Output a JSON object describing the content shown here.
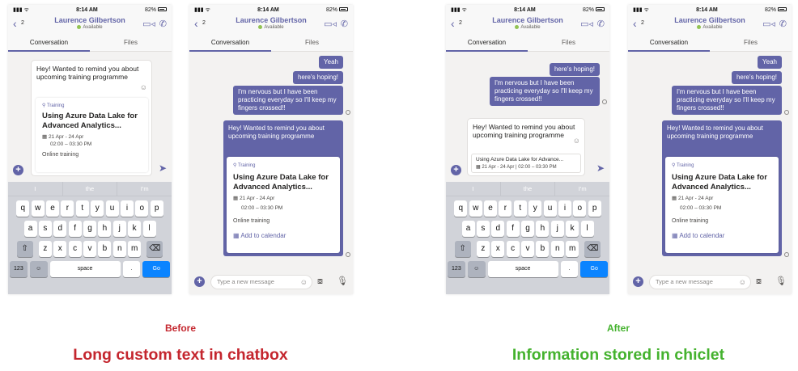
{
  "status": {
    "time": "8:14 AM",
    "battery": "82%"
  },
  "header": {
    "back_count": "2",
    "name": "Laurence Gilbertson",
    "presence": "Available"
  },
  "tabs": {
    "conversation": "Conversation",
    "files": "Files"
  },
  "messages": {
    "yeah": "Yeah",
    "hoping": "here's hoping!",
    "nervous": "I'm nervous but I have been practicing everyday so I'll keep my fingers crossed!!",
    "remind": "Hey! Wanted to remind you about upcoming training programme"
  },
  "card": {
    "tag": "Training",
    "title": "Using Azure Data Lake for Advanced Analytics...",
    "date": "21 Apr - 24 Apr",
    "time": "02:00 – 03:30 PM",
    "location": "Online training",
    "add_calendar": "Add to calendar"
  },
  "chiclet": {
    "title": "Using Azure Data Lake for Advance...",
    "details": "21 Apr - 24 Apr | 02:00 – 03:30 PM"
  },
  "compose": {
    "placeholder": "Type a new message"
  },
  "keyboard": {
    "suggestions": [
      "I",
      "the",
      "I'm"
    ],
    "row1": [
      "q",
      "w",
      "e",
      "r",
      "t",
      "y",
      "u",
      "i",
      "o",
      "p"
    ],
    "row2": [
      "a",
      "s",
      "d",
      "f",
      "g",
      "h",
      "j",
      "k",
      "l"
    ],
    "row3": [
      "z",
      "x",
      "c",
      "v",
      "b",
      "n",
      "m"
    ],
    "num_key": "123",
    "space_key": "space",
    "period_key": ".",
    "go_key": "Go"
  },
  "captions": {
    "before_label": "Before",
    "before_text": "Long custom text in chatbox",
    "after_label": "After",
    "after_text": "Information stored in chiclet"
  },
  "colors": {
    "brand": "#6264a7",
    "before": "#c4262e",
    "after": "#44b22e",
    "available": "#92c353"
  }
}
